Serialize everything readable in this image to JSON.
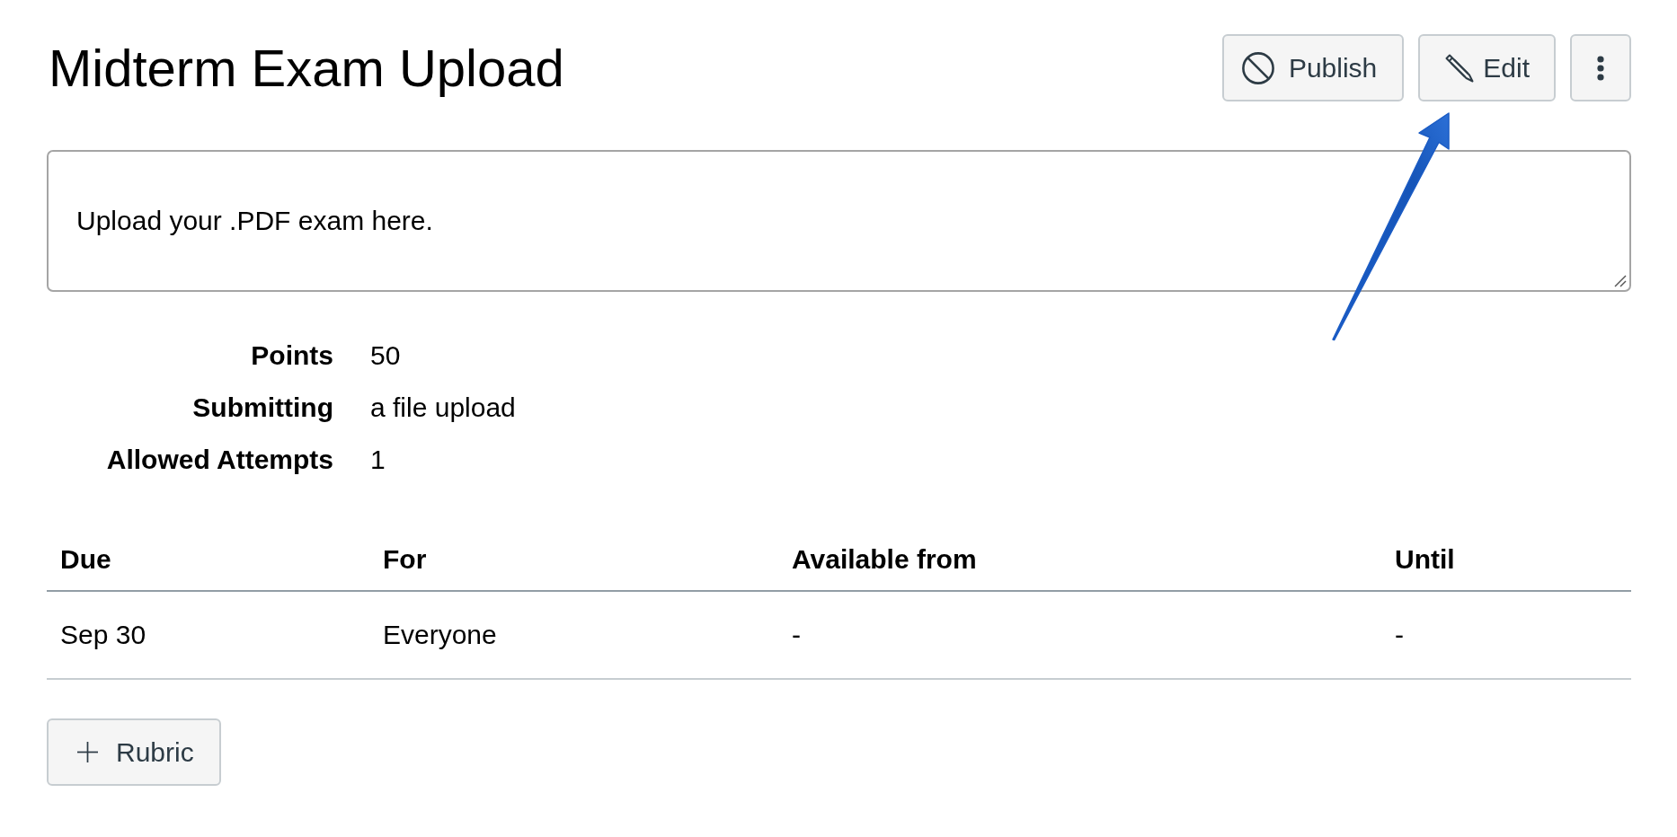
{
  "page": {
    "title": "Midterm Exam Upload"
  },
  "toolbar": {
    "buttons": [
      {
        "kind": "publish",
        "label": "Publish",
        "published": false
      },
      {
        "kind": "edit",
        "label": "Edit"
      },
      {
        "kind": "more"
      }
    ]
  },
  "description": {
    "value": "Upload your .PDF exam here."
  },
  "details": [
    {
      "label": "Points",
      "value": "50"
    },
    {
      "label": "Submitting",
      "value": "a file upload"
    },
    {
      "label": "Allowed Attempts",
      "value": "1"
    }
  ],
  "table": {
    "columns": [
      "Due",
      "For",
      "Available from",
      "Until"
    ],
    "rows": [
      [
        "Sep 30",
        "Everyone",
        "-",
        "-"
      ]
    ]
  },
  "rubric_button": {
    "label": "Rubric"
  }
}
